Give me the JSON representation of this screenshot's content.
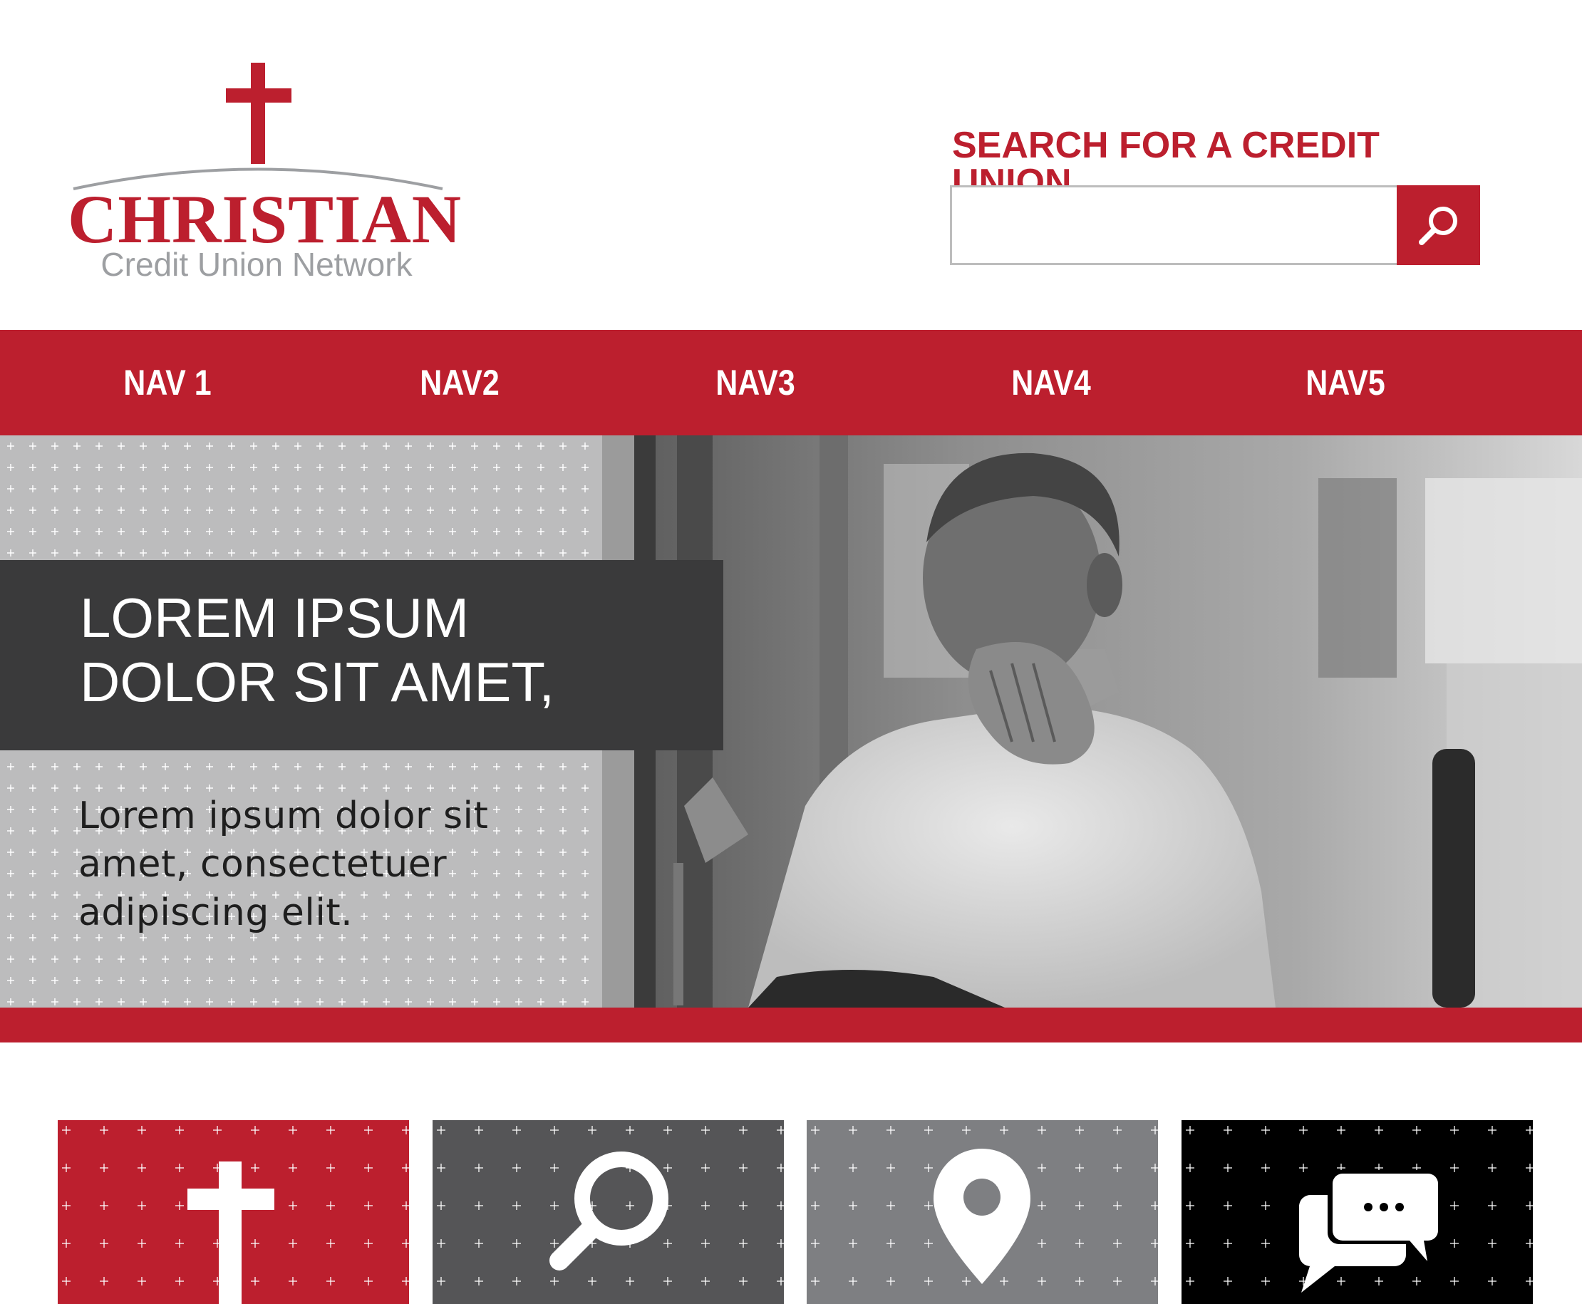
{
  "colors": {
    "brand_red": "#bc1f2e",
    "dark_gray": "#3a3a3b",
    "mid_gray": "#555557",
    "light_gray": "#7e7f82",
    "black": "#000000",
    "logo_gray": "#9d9fa2"
  },
  "logo": {
    "word": "CHRISTIAN",
    "subtitle": "Credit Union Network",
    "icon": "cross-icon"
  },
  "search": {
    "label": "SEARCH FOR A CREDIT UNION",
    "placeholder": "",
    "value": "",
    "button_icon": "search-icon"
  },
  "nav": {
    "items": [
      {
        "label": "NAV 1"
      },
      {
        "label": "NAV2"
      },
      {
        "label": "NAV3"
      },
      {
        "label": "NAV4"
      },
      {
        "label": "NAV5"
      }
    ]
  },
  "hero": {
    "title_line1": "LOREM IPSUM",
    "title_line2": "DOLOR SIT AMET,",
    "body_line1": "Lorem ipsum dolor sit",
    "body_line2": "amet, consectetuer",
    "body_line3": "adipiscing elit.",
    "photo": "praying-man-photo"
  },
  "tiles": [
    {
      "icon": "cross-icon",
      "color": "#bc1f2e"
    },
    {
      "icon": "search-icon",
      "color": "#555557"
    },
    {
      "icon": "location-pin-icon",
      "color": "#7e7f82"
    },
    {
      "icon": "chat-bubbles-icon",
      "color": "#000000"
    }
  ]
}
